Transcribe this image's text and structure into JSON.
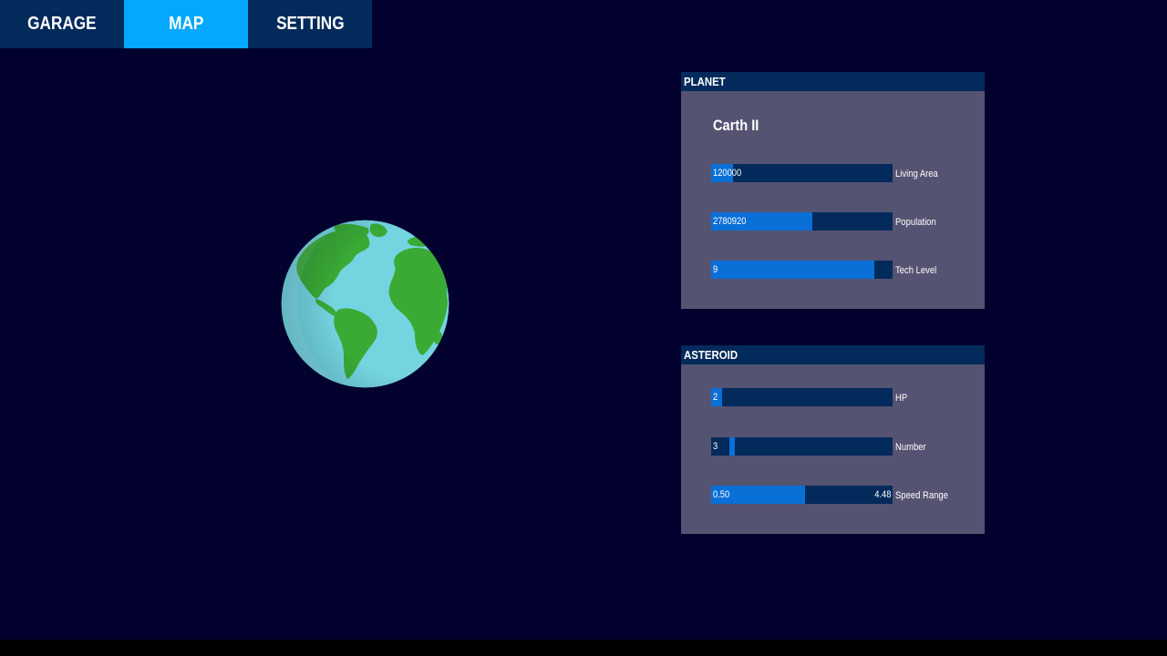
{
  "tabs": [
    {
      "label": "GARAGE",
      "active": false
    },
    {
      "label": "MAP",
      "active": true
    },
    {
      "label": "SETTING",
      "active": false
    }
  ],
  "planet_panel": {
    "title": "PLANET",
    "name": "Carth II",
    "stats": [
      {
        "label": "Living Area",
        "value": "120000",
        "fill": 0.12
      },
      {
        "label": "Population",
        "value": "2780920",
        "fill": 0.56
      },
      {
        "label": "Tech Level",
        "value": "9",
        "fill": 0.9
      }
    ]
  },
  "asteroid_panel": {
    "title": "ASTEROID",
    "hp": {
      "label": "HP",
      "value": "2",
      "fill": 0.06
    },
    "number": {
      "label": "Number",
      "value": "3",
      "marker": 0.1
    },
    "speed_range": {
      "label": "Speed Range",
      "min": "0.50",
      "max": "4.48",
      "fill": 0.52
    }
  },
  "colors": {
    "background": "#02002e",
    "tab": "#022a5b",
    "tab_active": "#04a8ff",
    "panel_header": "#022a5b",
    "panel_body": "#545372",
    "bar_track": "#022a5b",
    "bar_fill": "#0a6fd6",
    "ocean": "#74d4e0",
    "land": "#3aaa35"
  },
  "icons": {
    "planet": "earth-globe-icon"
  }
}
